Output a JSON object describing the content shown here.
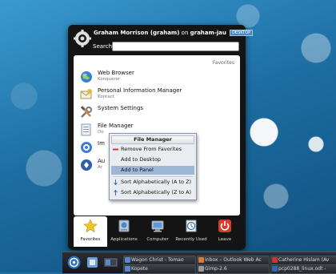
{
  "header": {
    "user_name": "Graham Morrison (graham)",
    "on_text": "on",
    "host": "graham-jau",
    "badge": "DESKTOP",
    "search_label": "Search:",
    "search_value": ""
  },
  "favorites": {
    "heading": "Favorites",
    "items": [
      {
        "name": "Web Browser",
        "sub": "Konqueror",
        "icon": "globe-icon"
      },
      {
        "name": "Personal Information Manager",
        "sub": "Kontact",
        "icon": "envelope-icon"
      },
      {
        "name": "System Settings",
        "sub": "",
        "icon": "tools-icon"
      },
      {
        "name": "File Manager",
        "sub": "Do",
        "icon": "folder-icon"
      },
      {
        "name": "Im",
        "sub": "",
        "icon": "messenger-icon"
      },
      {
        "name": "Au",
        "sub": "Ar",
        "icon": "dialog-icon"
      }
    ]
  },
  "context_menu": {
    "title": "File Manager",
    "items": [
      {
        "label": "Remove From Favorites",
        "icon": "remove-icon"
      },
      {
        "label": "Add to Desktop",
        "icon": ""
      },
      {
        "label": "Add to Panel",
        "icon": ""
      },
      {
        "label": "Sort Alphabetically (A to Z)",
        "icon": "sort-az-icon"
      },
      {
        "label": "Sort Alphabetically (Z to A)",
        "icon": "sort-za-icon"
      }
    ]
  },
  "tabs": [
    {
      "label": "Favorites",
      "icon": "star-icon",
      "active": true
    },
    {
      "label": "Applications",
      "icon": "applications-icon",
      "active": false
    },
    {
      "label": "Computer",
      "icon": "computer-icon",
      "active": false
    },
    {
      "label": "Recently Used",
      "icon": "clock-icon",
      "active": false
    },
    {
      "label": "Leave",
      "icon": "power-icon",
      "active": false
    }
  ],
  "taskbar": {
    "tasks": [
      {
        "label": "Wagon Christ - Tomao",
        "color": "#5588cc"
      },
      {
        "label": "Inbox – Outlook Web Ac",
        "color": "#dd7733"
      },
      {
        "label": "Catherine Hislam (Av",
        "color": "#cc3333"
      },
      {
        "label": "Kopete",
        "color": "#5588cc"
      },
      {
        "label": "Gimp-2.6",
        "color": "#999999"
      },
      {
        "label": "pcp0288_linux.odt -",
        "color": "#3366aa"
      }
    ]
  },
  "colors": {
    "launcher_bg": "#141414",
    "highlight": "#9fb7d6",
    "desktop_blue": "#1f6fa0"
  }
}
